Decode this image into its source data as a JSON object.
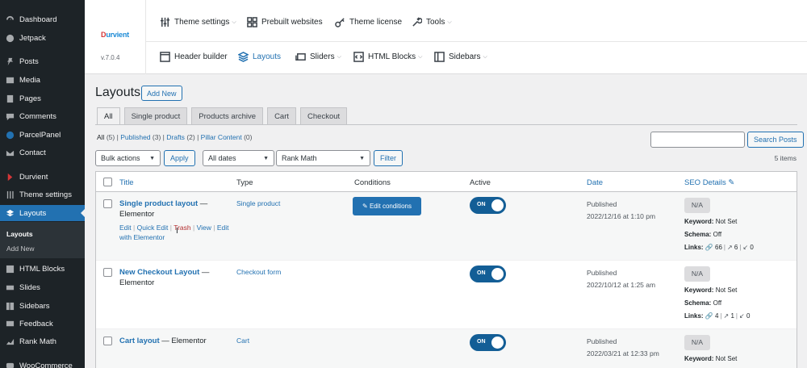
{
  "sidebar": {
    "items": [
      {
        "label": "Dashboard",
        "icon": "dashboard-icon"
      },
      {
        "label": "Jetpack",
        "icon": "jetpack-icon"
      },
      {
        "label": "Posts",
        "icon": "pin-icon"
      },
      {
        "label": "Media",
        "icon": "media-icon"
      },
      {
        "label": "Pages",
        "icon": "pages-icon"
      },
      {
        "label": "Comments",
        "icon": "comments-icon"
      },
      {
        "label": "ParcelPanel",
        "icon": "parcelpanel-icon"
      },
      {
        "label": "Contact",
        "icon": "mail-icon"
      },
      {
        "label": "Durvient",
        "icon": "durvient-icon"
      },
      {
        "label": "Theme settings",
        "icon": "sliders-icon"
      },
      {
        "label": "Layouts",
        "icon": "layers-icon"
      },
      {
        "label": "HTML Blocks",
        "icon": "blocks-icon"
      },
      {
        "label": "Slides",
        "icon": "slides-icon"
      },
      {
        "label": "Sidebars",
        "icon": "sidebars-icon"
      },
      {
        "label": "Feedback",
        "icon": "feedback-icon"
      },
      {
        "label": "Rank Math",
        "icon": "rankmath-icon"
      },
      {
        "label": "WooCommerce",
        "icon": "woo-icon"
      }
    ],
    "submenu": [
      "Layouts",
      "Add New"
    ]
  },
  "header": {
    "logo": "urvient",
    "logo_mark": "D",
    "version": "v.7.0.4",
    "top_nav": [
      "Theme settings",
      "Prebuilt websites",
      "Theme license",
      "Tools"
    ],
    "sub_nav": [
      "Header builder",
      "Layouts",
      "Sliders",
      "HTML Blocks",
      "Sidebars"
    ]
  },
  "page": {
    "title": "Layouts",
    "add_new": "Add New",
    "tabs": [
      "All",
      "Single product",
      "Products archive",
      "Cart",
      "Checkout"
    ],
    "views": {
      "all": "All",
      "all_count": "(5)",
      "published": "Published",
      "published_count": "(3)",
      "drafts": "Drafts",
      "drafts_count": "(2)",
      "pillar": "Pillar Content",
      "pillar_count": "(0)",
      "sep": "|"
    },
    "search_placeholder": "",
    "search_button": "Search Posts",
    "bulk_actions": "Bulk actions",
    "apply": "Apply",
    "dates": "All dates",
    "rank_math": "Rank Math",
    "filter": "Filter",
    "items_count": "5 items"
  },
  "table": {
    "columns": {
      "title": "Title",
      "type": "Type",
      "conditions": "Conditions",
      "active": "Active",
      "date": "Date",
      "seo": "SEO Details"
    },
    "rows": [
      {
        "title": "Single product layout",
        "suffix": " — Elementor",
        "type": "Single product",
        "conditions_button": "Edit conditions",
        "active": "ON",
        "status": "Published",
        "date": "2022/12/16 at 1:10 pm",
        "seo_score": "N/A",
        "keyword": "Keyword:",
        "keyword_val": "Not Set",
        "schema": "Schema:",
        "schema_val": "Off",
        "links": "Links:",
        "links_internal": "66",
        "links_external": "6",
        "links_incoming": "0",
        "actions": {
          "edit": "Edit",
          "quick_edit": "Quick Edit",
          "trash": "Trash",
          "view": "View",
          "edit_elementor": "Edit with Elementor",
          "sep": "|"
        }
      },
      {
        "title": "New Checkout Layout",
        "suffix": " — Elementor",
        "type": "Checkout form",
        "active": "ON",
        "status": "Published",
        "date": "2022/10/12 at 1:25 am",
        "seo_score": "N/A",
        "keyword": "Keyword:",
        "keyword_val": "Not Set",
        "schema": "Schema:",
        "schema_val": "Off",
        "links": "Links:",
        "links_internal": "4",
        "links_external": "1",
        "links_incoming": "0"
      },
      {
        "title": "Cart layout",
        "suffix": " — Elementor",
        "type": "Cart",
        "active": "ON",
        "status": "Published",
        "date": "2022/03/21 at 12:33 pm",
        "seo_score": "N/A",
        "keyword": "Keyword:",
        "keyword_val": "Not Set"
      }
    ]
  },
  "colors": {
    "admin_bar": "#1d2327",
    "accent": "#2271b1",
    "toggle": "#135e96"
  }
}
